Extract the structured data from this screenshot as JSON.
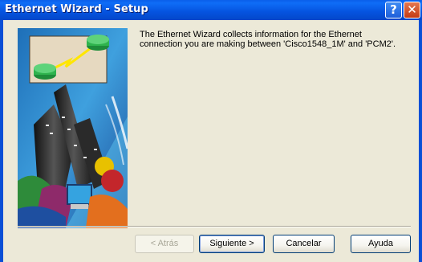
{
  "window": {
    "title": "Ethernet Wizard - Setup",
    "help_glyph": "?",
    "close_glyph": "✕"
  },
  "message": {
    "line1": "The Ethernet Wizard collects information for the Ethernet",
    "line2": "connection you are making between 'Cisco1548_1M' and 'PCM2'."
  },
  "buttons": {
    "back": "< Atrás",
    "next": "Siguiente >",
    "cancel": "Cancelar",
    "help": "Ayuda"
  },
  "colors": {
    "titlebar": "#0553DF",
    "dialog_bg": "#ECE9D8",
    "close_button": "#C43B15"
  }
}
